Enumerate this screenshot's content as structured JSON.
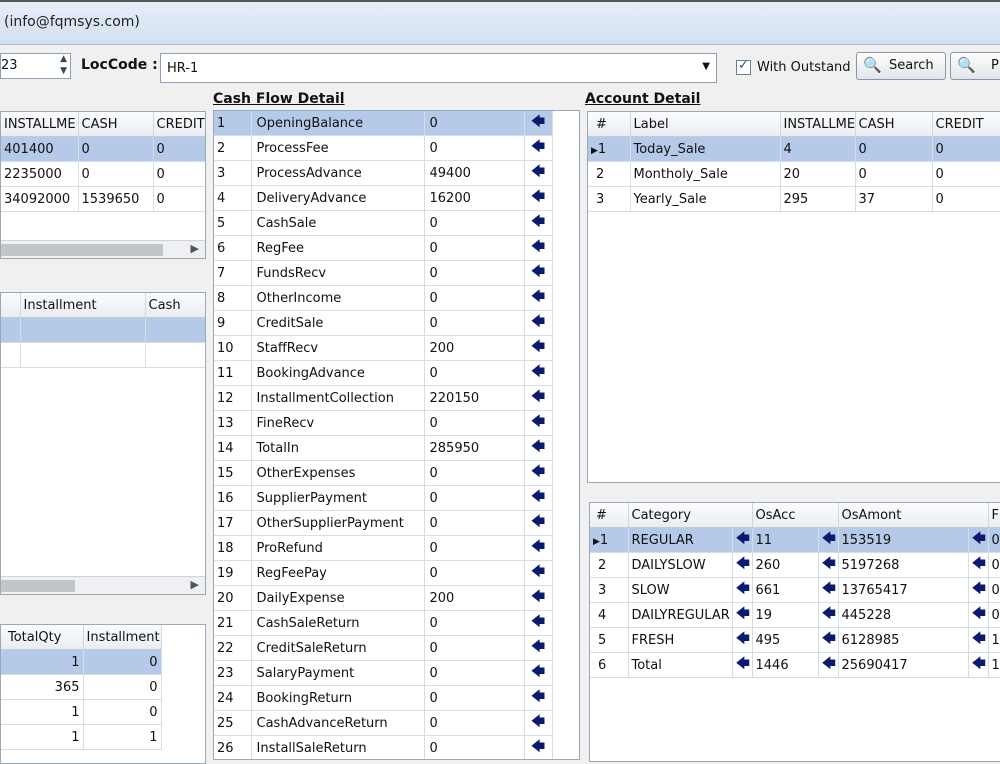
{
  "window": {
    "title": "(info@fqmsys.com)"
  },
  "filters": {
    "left_value": "23",
    "loccode_label": "LocCode :",
    "loccode_value": "HR-1",
    "with_outstand_label": "With Outstand",
    "with_outstand_checked": true,
    "search_label": "Search",
    "second_button_label": "P"
  },
  "left_grid1": {
    "headers": [
      "INSTALLME",
      "CASH",
      "CREDIT"
    ],
    "rows": [
      [
        "401400",
        "0",
        "0"
      ],
      [
        "2235000",
        "0",
        "0"
      ],
      [
        "34092000",
        "1539650",
        "0"
      ]
    ]
  },
  "left_grid2": {
    "headers": [
      "Installment",
      "Cash"
    ]
  },
  "left_grid3": {
    "headers": [
      "TotalQty",
      "Installment"
    ],
    "rows": [
      [
        "1",
        "0"
      ],
      [
        "365",
        "0"
      ],
      [
        "1",
        "0"
      ],
      [
        "1",
        "1"
      ]
    ]
  },
  "cash_flow": {
    "title": "Cash Flow Detail",
    "rows": [
      [
        "1",
        "OpeningBalance",
        "0"
      ],
      [
        "2",
        "ProcessFee",
        "0"
      ],
      [
        "3",
        "ProcessAdvance",
        "49400"
      ],
      [
        "4",
        "DeliveryAdvance",
        "16200"
      ],
      [
        "5",
        "CashSale",
        "0"
      ],
      [
        "6",
        "RegFee",
        "0"
      ],
      [
        "7",
        "FundsRecv",
        "0"
      ],
      [
        "8",
        "OtherIncome",
        "0"
      ],
      [
        "9",
        "CreditSale",
        "0"
      ],
      [
        "10",
        "StaffRecv",
        "200"
      ],
      [
        "11",
        "BookingAdvance",
        "0"
      ],
      [
        "12",
        "InstallmentCollection",
        "220150"
      ],
      [
        "13",
        "FineRecv",
        "0"
      ],
      [
        "14",
        "TotalIn",
        "285950"
      ],
      [
        "15",
        "OtherExpenses",
        "0"
      ],
      [
        "16",
        "SupplierPayment",
        "0"
      ],
      [
        "17",
        "OtherSupplierPayment",
        "0"
      ],
      [
        "18",
        "ProRefund",
        "0"
      ],
      [
        "19",
        "RegFeePay",
        "0"
      ],
      [
        "20",
        "DailyExpense",
        "200"
      ],
      [
        "21",
        "CashSaleReturn",
        "0"
      ],
      [
        "22",
        "CreditSaleReturn",
        "0"
      ],
      [
        "23",
        "SalaryPayment",
        "0"
      ],
      [
        "24",
        "BookingReturn",
        "0"
      ],
      [
        "25",
        "CashAdvanceReturn",
        "0"
      ],
      [
        "26",
        "InstallSaleReturn",
        "0"
      ]
    ]
  },
  "account_detail": {
    "title": "Account Detail",
    "headers": [
      "#",
      "Label",
      "INSTALLME",
      "CASH",
      "CREDIT"
    ],
    "rows": [
      [
        "1",
        "Today_Sale",
        "4",
        "0",
        "0"
      ],
      [
        "2",
        "Montholy_Sale",
        "20",
        "0",
        "0"
      ],
      [
        "3",
        "Yearly_Sale",
        "295",
        "37",
        "0"
      ]
    ]
  },
  "category_grid": {
    "headers": [
      "#",
      "Category",
      "OsAcc",
      "OsAmont",
      "F"
    ],
    "rows": [
      [
        "1",
        "REGULAR",
        "11",
        "153519",
        "0"
      ],
      [
        "2",
        "DAILYSLOW",
        "260",
        "5197268",
        "0"
      ],
      [
        "3",
        "SLOW",
        "661",
        "13765417",
        "0"
      ],
      [
        "4",
        "DAILYREGULAR",
        "19",
        "445228",
        "0"
      ],
      [
        "5",
        "FRESH",
        "495",
        "6128985",
        "1"
      ],
      [
        "6",
        "Total",
        "1446",
        "25690417",
        "1"
      ]
    ]
  },
  "icons": {
    "arrow": "left-arrow-icon",
    "search": "magnifier-icon"
  },
  "colors": {
    "selection": "#b5c9e8",
    "arrow": "#0a1a6e"
  }
}
